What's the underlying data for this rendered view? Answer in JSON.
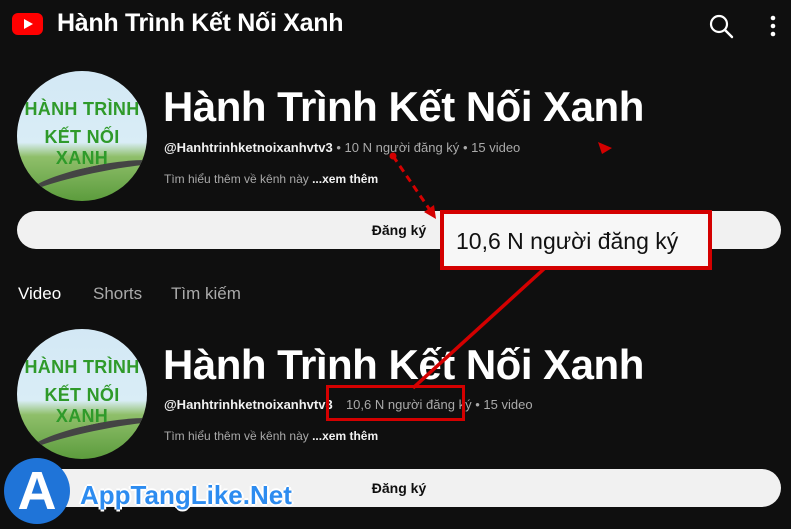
{
  "header": {
    "title": "Hành Trình Kết Nối Xanh"
  },
  "channel": {
    "name": "Hành Trình Kết Nối Xanh",
    "handle": "@Hanhtrinhketnoixanhvtv3",
    "subscribers_before": "10 N người đăng ký",
    "subscribers_after": "10,6 N người đăng ký",
    "separator": "•",
    "videos": "15 video",
    "description": "Tìm hiểu thêm về kênh này",
    "more_label": "...xem thêm",
    "subscribe_label": "Đăng ký",
    "avatar_line1": "HÀNH TRÌNH",
    "avatar_line2": "KẾT NỐI XANH"
  },
  "tabs": [
    {
      "label": "Video",
      "active": true
    },
    {
      "label": "Shorts",
      "active": false
    },
    {
      "label": "Tìm kiếm",
      "active": false
    }
  ],
  "highlight": {
    "text": "10,6 N người đăng ký"
  },
  "watermark": {
    "letter": "A",
    "text": "AppTangLike.Net"
  },
  "colors": {
    "youtube_red": "#ff0000",
    "highlight_red": "#d40000",
    "watermark_blue": "#2d8cf0"
  },
  "icons": {
    "logo": "youtube-logo-icon",
    "search": "search-icon",
    "more": "more-vert-icon"
  }
}
